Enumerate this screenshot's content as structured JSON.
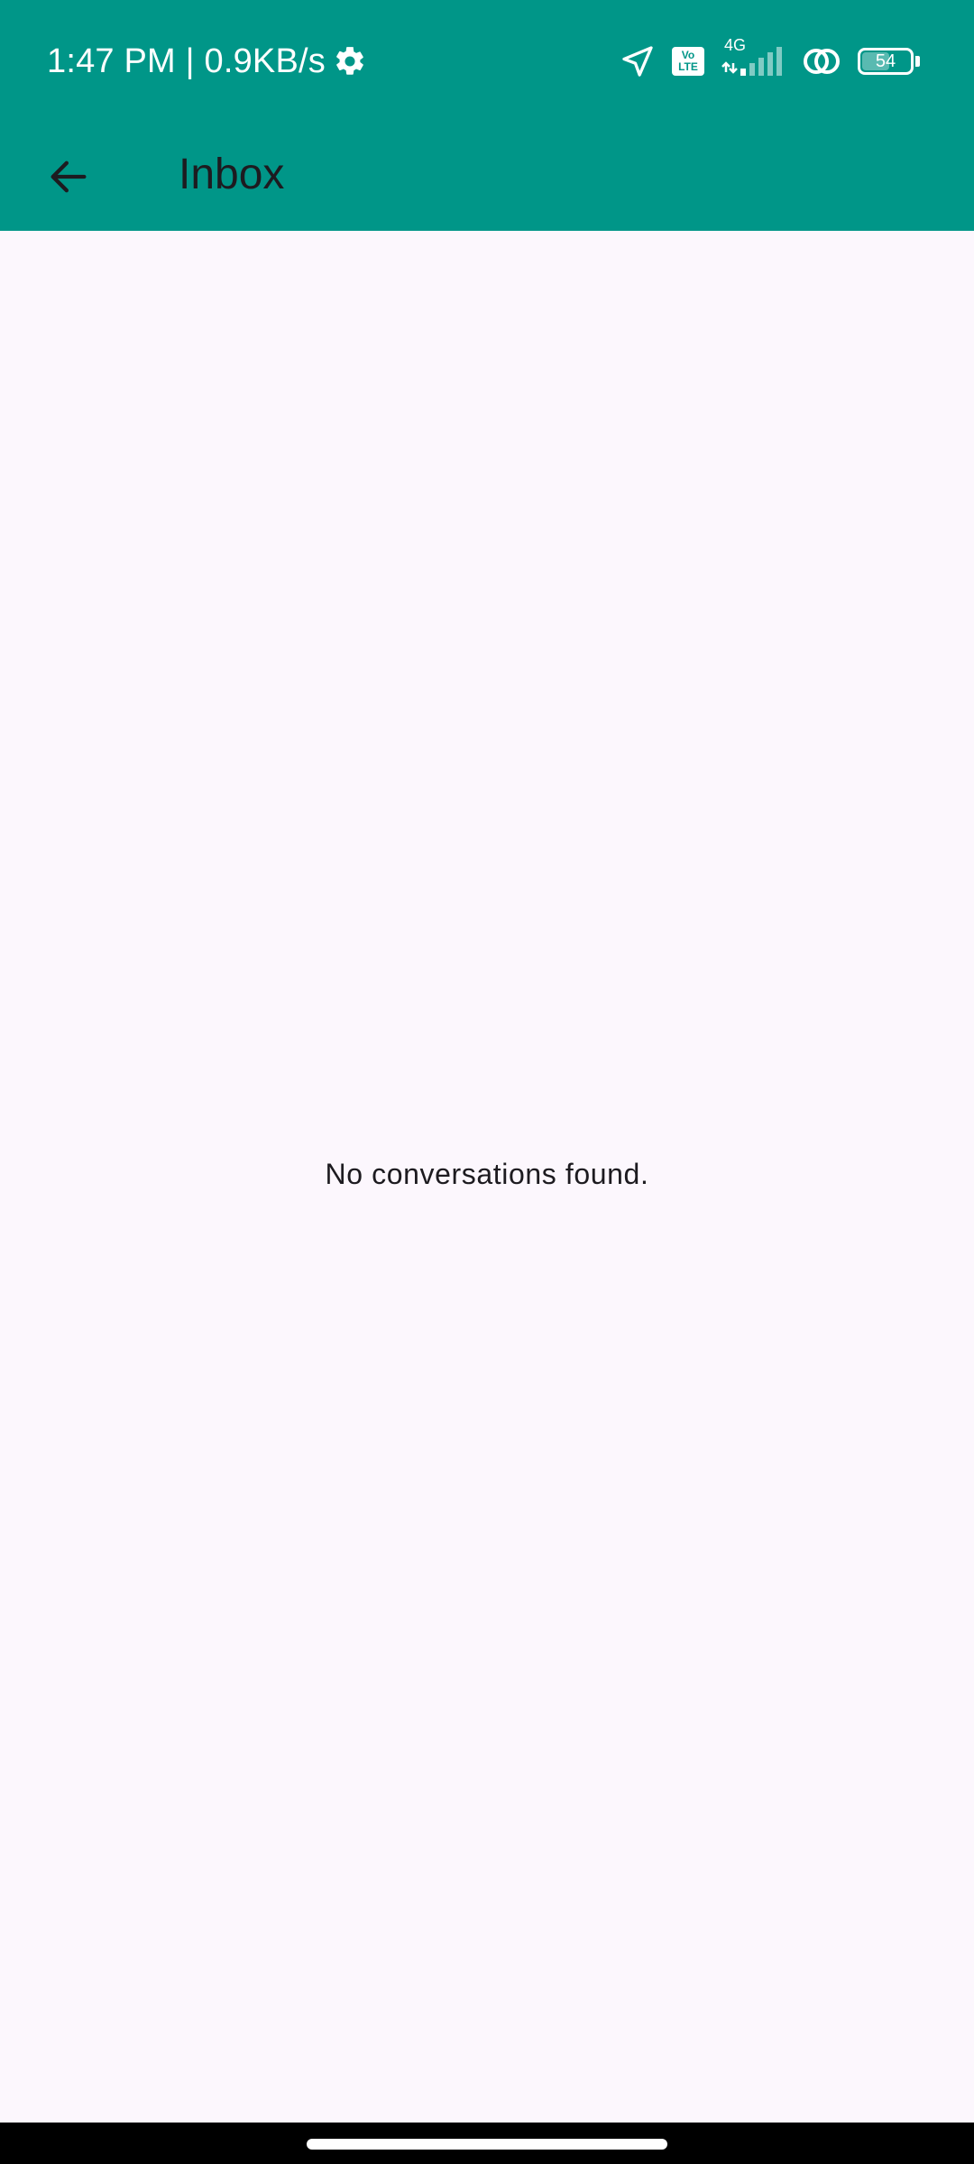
{
  "status_bar": {
    "time_speed": "1:47 PM | 0.9KB/s",
    "volte_label": "Vo\nLTE",
    "network_type": "4G",
    "battery_level": "54",
    "icons": [
      "gear-icon",
      "location-arrow-icon",
      "volte-icon",
      "signal-icon",
      "link-icon",
      "battery-icon"
    ]
  },
  "app_bar": {
    "title": "Inbox",
    "back_icon": "arrow-left-icon"
  },
  "main": {
    "empty_message": "No conversations found."
  },
  "colors": {
    "accent": "#009688",
    "background": "#fcf7fd",
    "text": "#1d1b20"
  }
}
